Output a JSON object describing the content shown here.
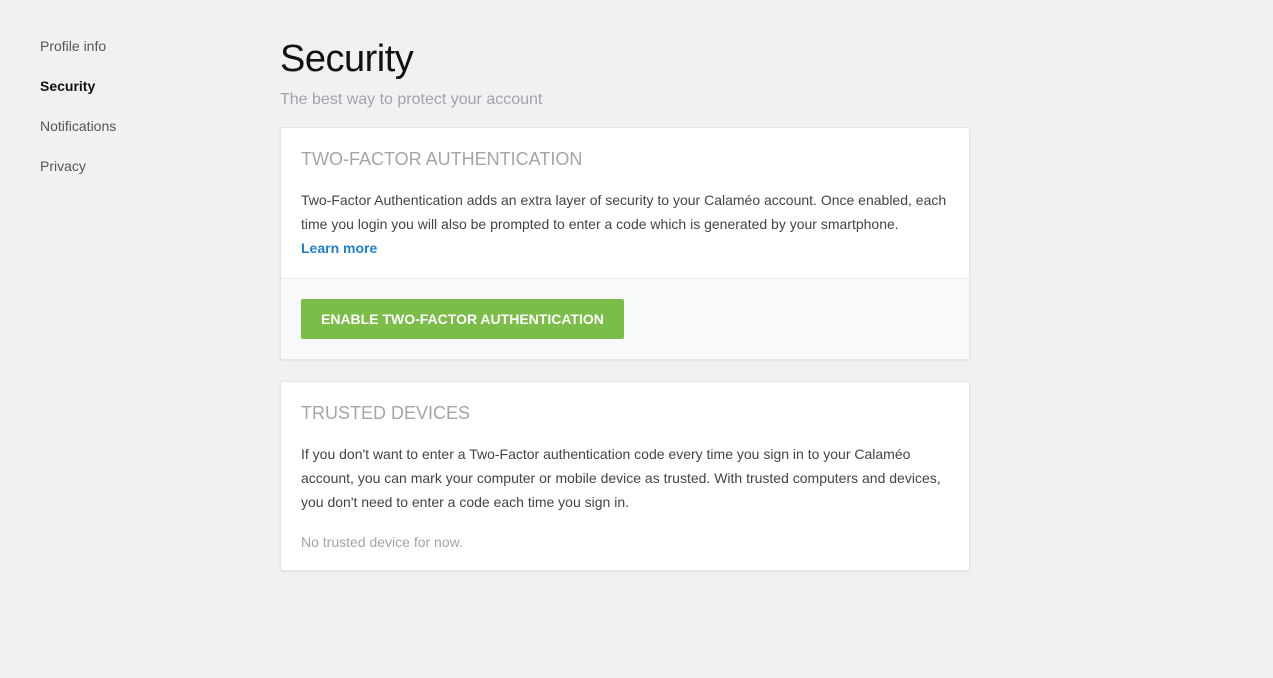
{
  "sidebar": {
    "items": [
      {
        "label": "Profile info"
      },
      {
        "label": "Security"
      },
      {
        "label": "Notifications"
      },
      {
        "label": "Privacy"
      }
    ]
  },
  "main": {
    "title": "Security",
    "subtitle": "The best way to protect your account",
    "two_factor": {
      "title": "TWO-FACTOR AUTHENTICATION",
      "description": "Two-Factor Authentication adds an extra layer of security to your Calaméo account. Once enabled, each time you login you will also be prompted to enter a code which is generated by your smartphone.",
      "learn_more": "Learn more",
      "enable_button": "ENABLE TWO-FACTOR AUTHENTICATION"
    },
    "trusted_devices": {
      "title": "TRUSTED DEVICES",
      "description": "If you don't want to enter a Two-Factor authentication code every time you sign in to your Calaméo account, you can mark your computer or mobile device as trusted. With trusted computers and devices, you don't need to enter a code each time you sign in.",
      "empty": "No trusted device for now."
    }
  },
  "colors": {
    "background": "#f0f1f3",
    "accent_button": "#7cbd4a",
    "link": "#1d7fd1"
  }
}
